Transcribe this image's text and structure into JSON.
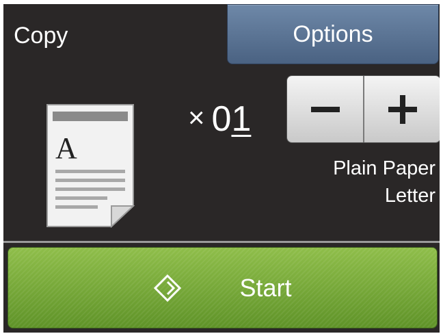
{
  "header": {
    "title": "Copy",
    "options_label": "Options"
  },
  "copies": {
    "prefix": "×",
    "value_lead": "0",
    "value_tail": "1"
  },
  "stepper": {
    "minus_icon": "minus-icon",
    "plus_icon": "plus-icon"
  },
  "paper": {
    "type": "Plain Paper",
    "size": "Letter"
  },
  "start": {
    "label": "Start",
    "icon": "start-diamond-icon"
  },
  "colors": {
    "background": "#2a2727",
    "options": "#5b7595",
    "start": "#76a83a"
  }
}
